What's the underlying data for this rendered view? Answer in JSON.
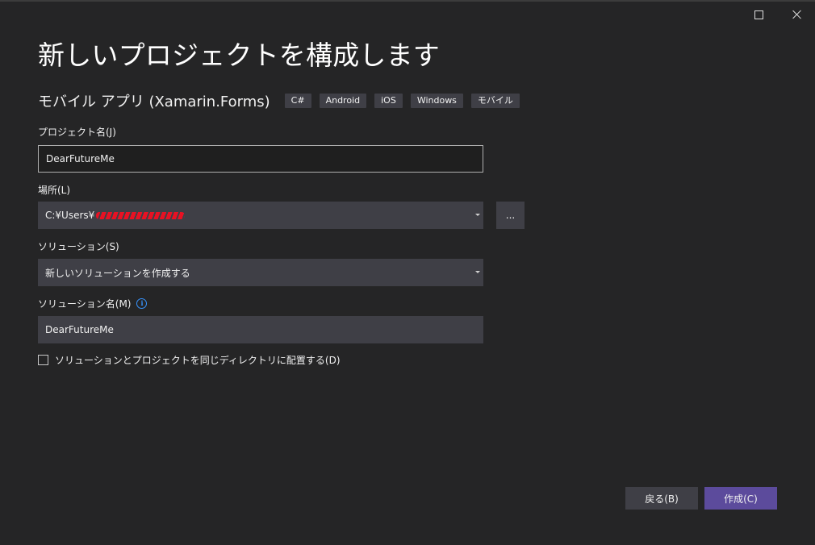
{
  "window": {
    "maximize_icon": "maximize-icon",
    "close_icon": "close-icon"
  },
  "header": {
    "title": "新しいプロジェクトを構成します",
    "template_name": "モバイル アプリ (Xamarin.Forms)",
    "tags": [
      "C#",
      "Android",
      "iOS",
      "Windows",
      "モバイル"
    ]
  },
  "form": {
    "project_name": {
      "label": "プロジェクト名(J)",
      "value": "DearFutureMe"
    },
    "location": {
      "label": "場所(L)",
      "value": "C:¥Users¥",
      "browse_label": "..."
    },
    "solution": {
      "label": "ソリューション(S)",
      "value": "新しいソリューションを作成する"
    },
    "solution_name": {
      "label": "ソリューション名(M)",
      "value": "DearFutureMe",
      "info_icon": "info-icon"
    },
    "same_directory": {
      "label": "ソリューションとプロジェクトを同じディレクトリに配置する(D)",
      "checked": false
    }
  },
  "footer": {
    "back_label": "戻る(B)",
    "create_label": "作成(C)"
  },
  "colors": {
    "background": "#252526",
    "field_background": "#3f3f46",
    "primary_button": "#5c4b9c",
    "info_accent": "#3794ff"
  }
}
